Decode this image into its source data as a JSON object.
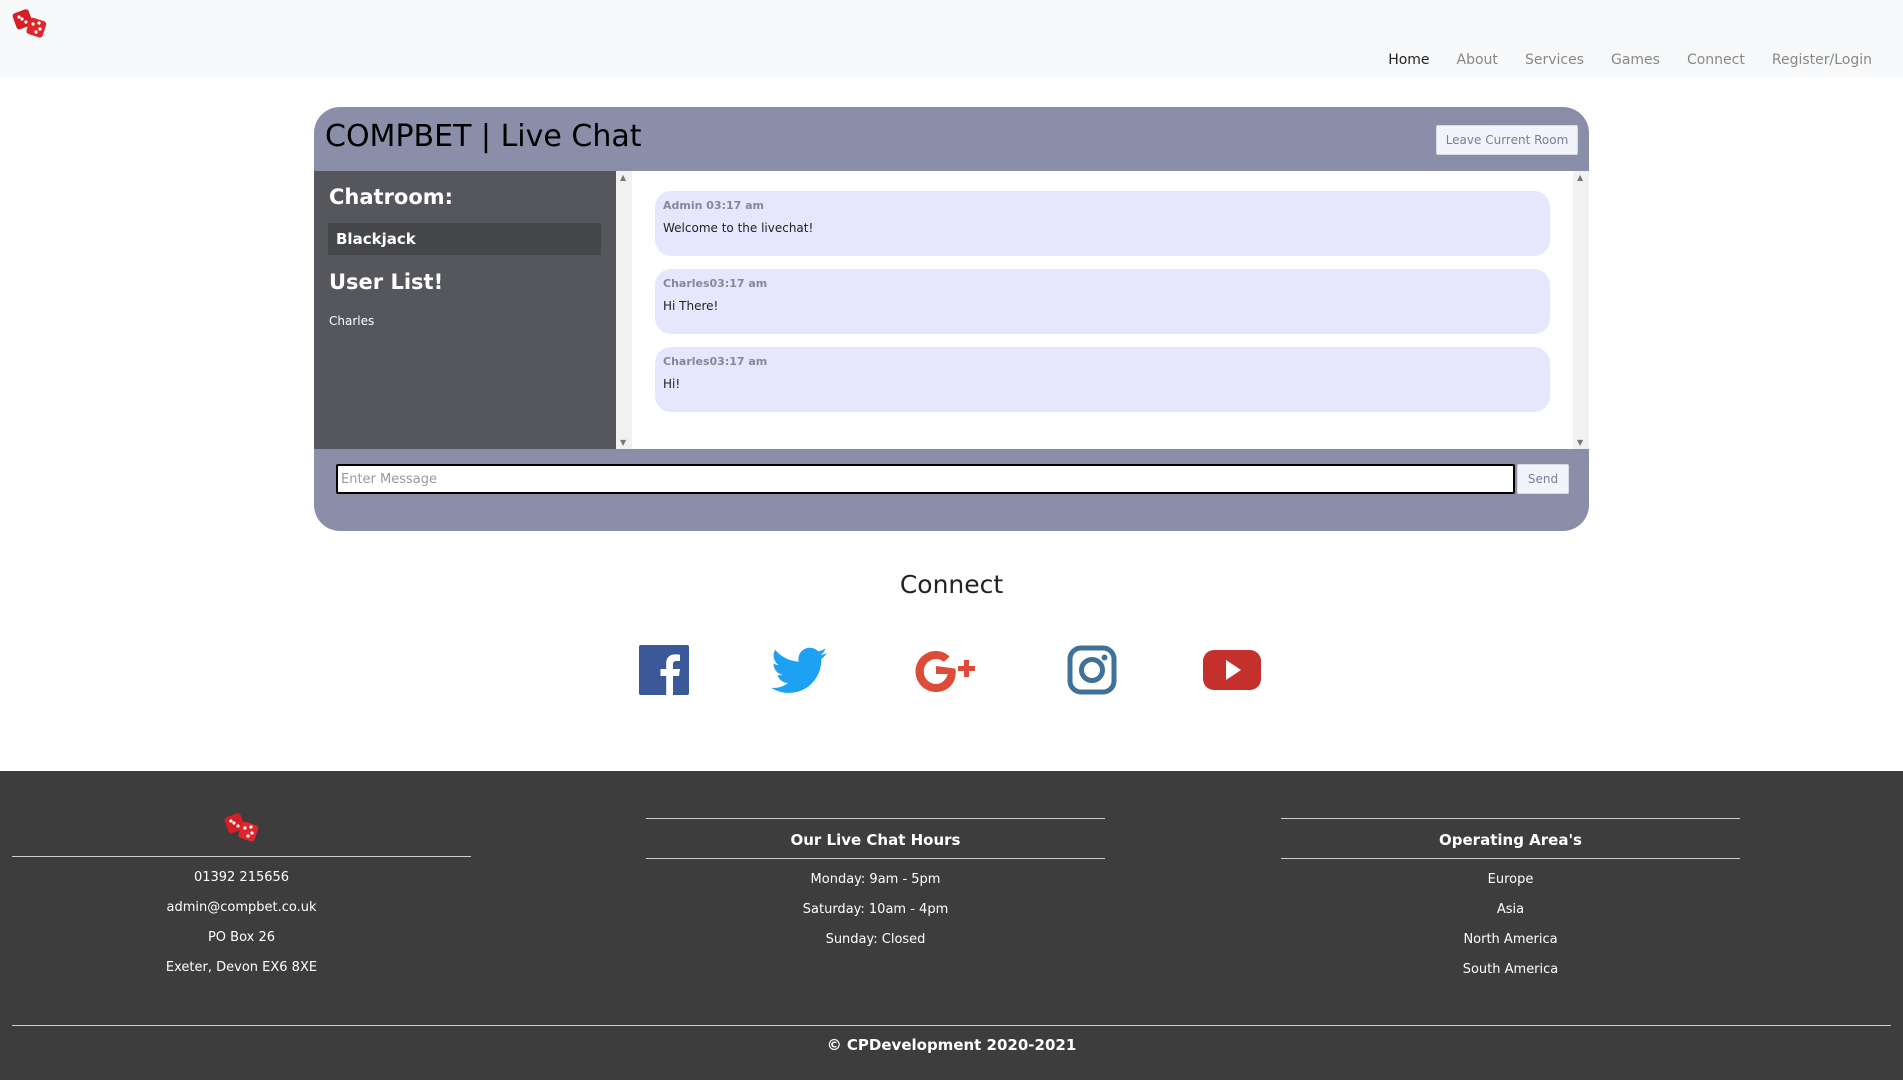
{
  "nav": {
    "logo": "dice-logo",
    "links": [
      "Home",
      "About",
      "Services",
      "Games",
      "Connect",
      "Register/Login"
    ],
    "active": "Home"
  },
  "chat": {
    "title": "COMPBET | Live Chat",
    "leave_button": "Leave Current Room",
    "chatroom_heading": "Chatroom:",
    "room_name": "Blackjack",
    "userlist_heading": "User List!",
    "users": [
      "Charles"
    ],
    "messages": [
      {
        "author": "Admin",
        "time": "03:17 am",
        "meta": "Admin 03:17 am",
        "text": "Welcome to the livechat!"
      },
      {
        "author": "Charles",
        "time": "03:17 am",
        "meta": "Charles03:17 am",
        "text": "Hi There!"
      },
      {
        "author": "Charles",
        "time": "03:17 am",
        "meta": "Charles03:17 am",
        "text": "Hi!"
      }
    ],
    "input_placeholder": "Enter Message",
    "send_button": "Send"
  },
  "connect": {
    "heading": "Connect",
    "icons": [
      "facebook-icon",
      "twitter-icon",
      "google-plus-icon",
      "instagram-icon",
      "youtube-icon"
    ]
  },
  "footer": {
    "contact": {
      "phone": "01392 215656",
      "email": "admin@compbet.co.uk",
      "po_box": "PO Box 26",
      "address": "Exeter, Devon EX6 8XE"
    },
    "hours": {
      "title": "Our Live Chat Hours",
      "items": [
        "Monday: 9am - 5pm",
        "Saturday: 10am - 4pm",
        "Sunday: Closed"
      ]
    },
    "areas": {
      "title": "Operating Area's",
      "items": [
        "Europe",
        "Asia",
        "North America",
        "South America"
      ]
    },
    "copyright": "© CPDevelopment 2020-2021"
  },
  "colors": {
    "chat_frame": "#8a8ea8",
    "sidebar": "#55575d",
    "message_bubble": "#e6e7fc",
    "footer_bg": "#3d3d3d",
    "facebook": "#3b5998",
    "twitter": "#1da1f2",
    "google_plus": "#dd4b39",
    "instagram": "#3f729b",
    "youtube": "#c4302b"
  }
}
